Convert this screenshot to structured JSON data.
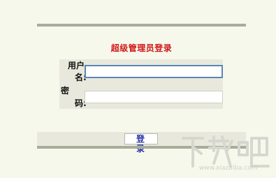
{
  "login": {
    "title": "超级管理员登录",
    "username_label_line1": "用户",
    "username_label_line2": "名:",
    "password_label_line1": "密",
    "password_label_line2": "码:",
    "username_value": "",
    "password_value": "",
    "login_button_label": "登 录"
  },
  "watermark": {
    "logo_text": "下载吧",
    "url": "www.xiazaiba.com"
  }
}
